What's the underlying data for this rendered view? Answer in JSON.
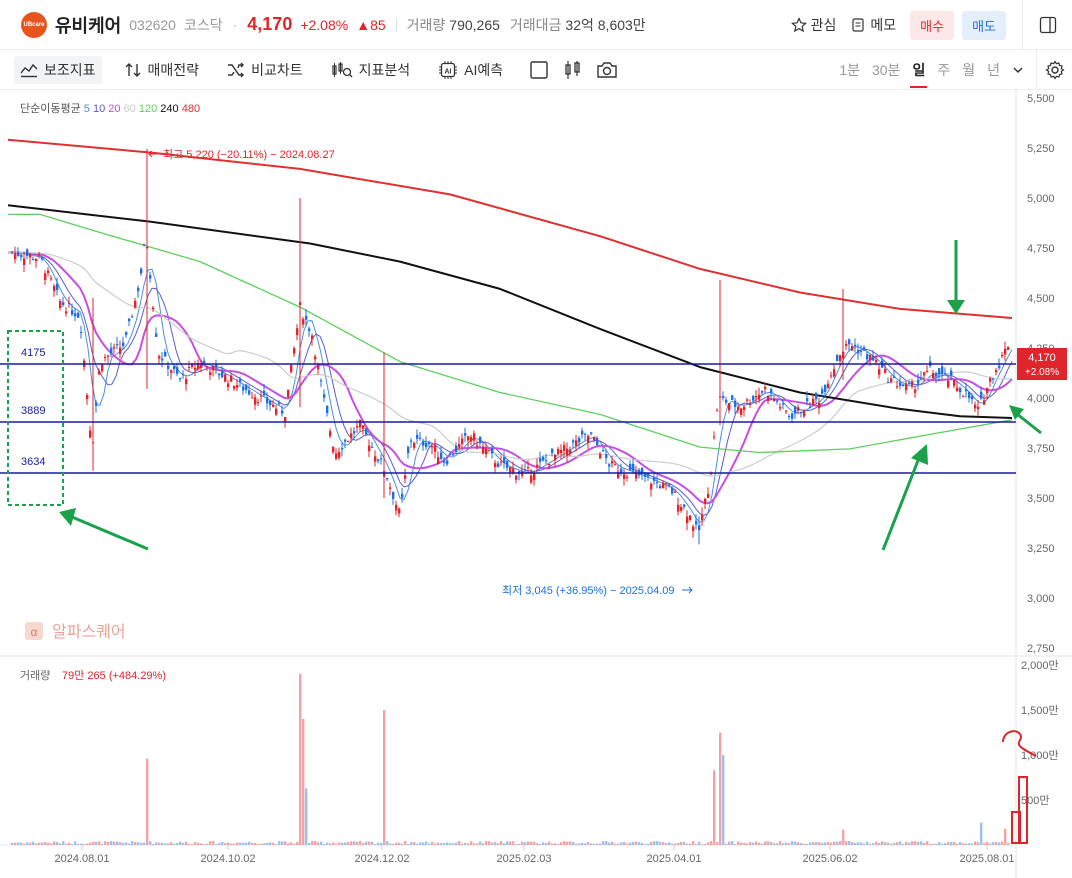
{
  "header": {
    "logo_text": "UBcare",
    "name": "유비케어",
    "code": "032620",
    "market": "코스닥",
    "price": "4,170",
    "change_pct": "+2.08%",
    "change_amount": "85",
    "volume_label": "거래량",
    "volume_value": "790,265",
    "amount_label": "거래대금",
    "amount_value": "32억 8,603만",
    "watch_label": "관심",
    "memo_label": "메모",
    "buy_label": "매수",
    "sell_label": "매도"
  },
  "toolbar": {
    "tools": [
      "보조지표",
      "매매전략",
      "비교차트",
      "지표분석",
      "AI예측"
    ],
    "periods": [
      "1분",
      "30분",
      "일",
      "주",
      "월",
      "년"
    ],
    "active_period": "일"
  },
  "chart": {
    "ma_label": "단순이동평균",
    "ma_periods": [
      {
        "value": "5",
        "color": "#4a90e2"
      },
      {
        "value": "10",
        "color": "#5b5bd6"
      },
      {
        "value": "20",
        "color": "#c64fe0"
      },
      {
        "value": "60",
        "color": "#cccccc"
      },
      {
        "value": "120",
        "color": "#5ecf5e"
      },
      {
        "value": "240",
        "color": "#111111"
      },
      {
        "value": "480",
        "color": "#e03030"
      }
    ],
    "high_note": "최고 5,220 (−20.11%) − 2024.08.27",
    "low_note": "최저 3,045 (+36.95%) − 2025.04.09",
    "price_axis": [
      "5,500",
      "5,250",
      "5,000",
      "4,750",
      "4,500",
      "4,250",
      "4,000",
      "3,750",
      "3,500",
      "3,250",
      "3,000",
      "2,750"
    ],
    "current_price_tag": "4,170",
    "current_pct_tag": "+2.08%",
    "levels": [
      "4175",
      "3889",
      "3634"
    ],
    "watermark": "알파스퀘어",
    "volume_label": "거래량",
    "volume_value": "79만 265 (+484.29%)",
    "volume_axis": [
      "2,000만",
      "1,500만",
      "1,000만",
      "500만"
    ],
    "date_axis": [
      "2024.08.01",
      "2024.10.02",
      "2024.12.02",
      "2025.02.03",
      "2025.04.01",
      "2025.06.02",
      "2025.08.01"
    ],
    "up_color": "#e0242b",
    "down_color": "#1f6fe0"
  }
}
